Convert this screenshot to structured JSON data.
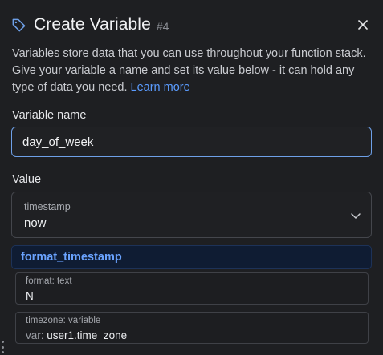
{
  "header": {
    "icon": "tag-icon",
    "title": "Create Variable",
    "step": "#4",
    "close_icon": "close-icon"
  },
  "description": {
    "text": "Variables store data that you can use throughout your function stack. Give your variable a name and set its value below - it can hold any type of data you need.",
    "link_label": "Learn more"
  },
  "name_field": {
    "label": "Variable name",
    "value": "day_of_week"
  },
  "value_field": {
    "label": "Value",
    "type_label": "timestamp",
    "selected": "now"
  },
  "filter": {
    "name": "format_timestamp",
    "params": [
      {
        "label": "format: text",
        "prefix": "",
        "value": "N"
      },
      {
        "label": "timezone: variable",
        "prefix": "var:",
        "value": "user1.time_zone"
      }
    ]
  },
  "colors": {
    "accent": "#6ea0e8",
    "link": "#5b9cff",
    "filter_bg": "#0f1c33",
    "background": "#1e1f22"
  }
}
